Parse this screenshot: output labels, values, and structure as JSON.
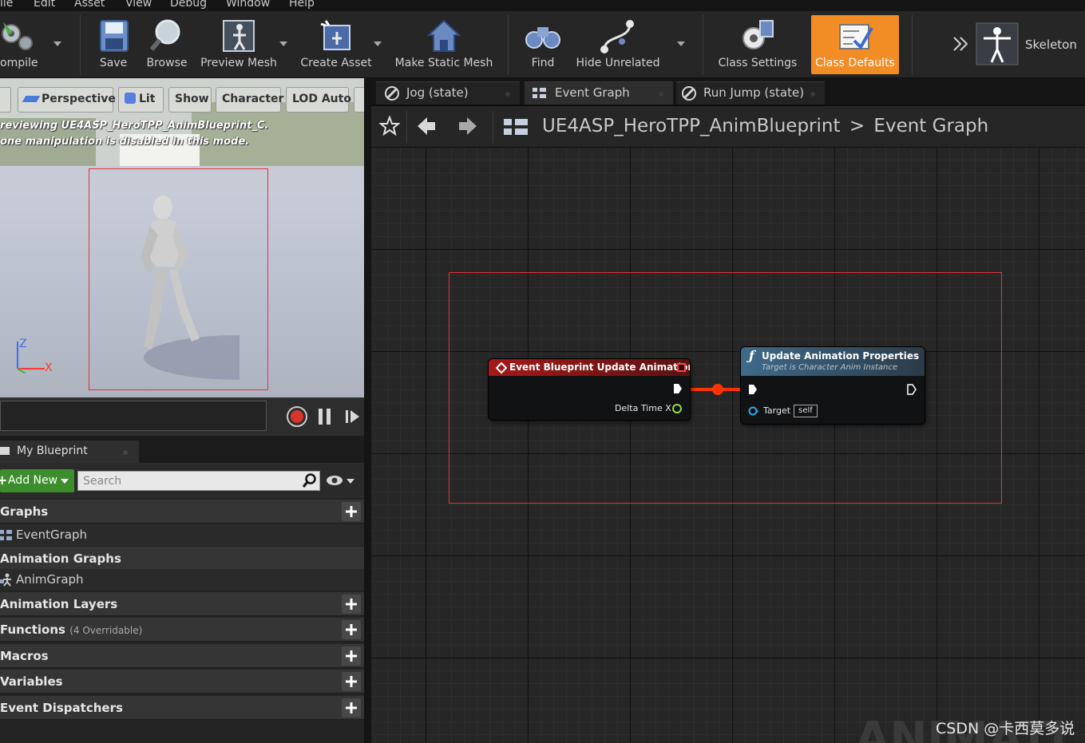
{
  "menu": [
    "ile",
    "Edit",
    "Asset",
    "View",
    "Debug",
    "Window",
    "Help"
  ],
  "toolbar": {
    "compile": "ompile",
    "save": "Save",
    "browse": "Browse",
    "preview_mesh": "Preview Mesh",
    "create_asset": "Create Asset",
    "make_static_mesh": "Make Static Mesh",
    "find": "Find",
    "hide_unrelated": "Hide Unrelated",
    "class_settings": "Class Settings",
    "class_defaults": "Class Defaults",
    "skeleton": "Skeleton"
  },
  "viewport": {
    "buttons": [
      "Perspective",
      "Lit",
      "Show",
      "Character",
      "LOD Auto"
    ],
    "message_line1": "reviewing UE4ASP_HeroTPP_AnimBlueprint_C.",
    "message_line2": "one manipulation is disabled in this mode.",
    "axis_z": "Z",
    "axis_x": "X"
  },
  "my_blueprint": {
    "tab_label": "My Blueprint",
    "add_new": "Add New",
    "search_placeholder": "Search",
    "categories": {
      "graphs": "Graphs",
      "event_graph": "EventGraph",
      "animation_graphs": "Animation Graphs",
      "anim_graph": "AnimGraph",
      "animation_layers": "Animation Layers",
      "functions": "Functions",
      "functions_sub": "(4 Overridable)",
      "macros": "Macros",
      "variables": "Variables",
      "event_dispatchers": "Event Dispatchers"
    }
  },
  "graph_tabs": [
    "Jog (state)",
    "Event Graph",
    "Run Jump (state)"
  ],
  "breadcrumb": {
    "blueprint": "UE4ASP_HeroTPP_AnimBlueprint",
    "separator": ">",
    "graph": "Event Graph"
  },
  "nodes": {
    "event": {
      "title": "Event Blueprint Update Animation",
      "pin_delta": "Delta Time X"
    },
    "function": {
      "title": "Update Animation Properties",
      "subtitle": "Target is Character Anim Instance",
      "pin_target": "Target",
      "target_value": "self"
    }
  },
  "watermark": "CSDN @卡西莫多说",
  "colors": {
    "accent_orange": "#f28c24",
    "event_red": "#a51919",
    "function_blue": "#3e6a8a",
    "exec_wire": "#ff3300",
    "add_new_green": "#3c8e2c",
    "selection_red": "#e0363a"
  }
}
